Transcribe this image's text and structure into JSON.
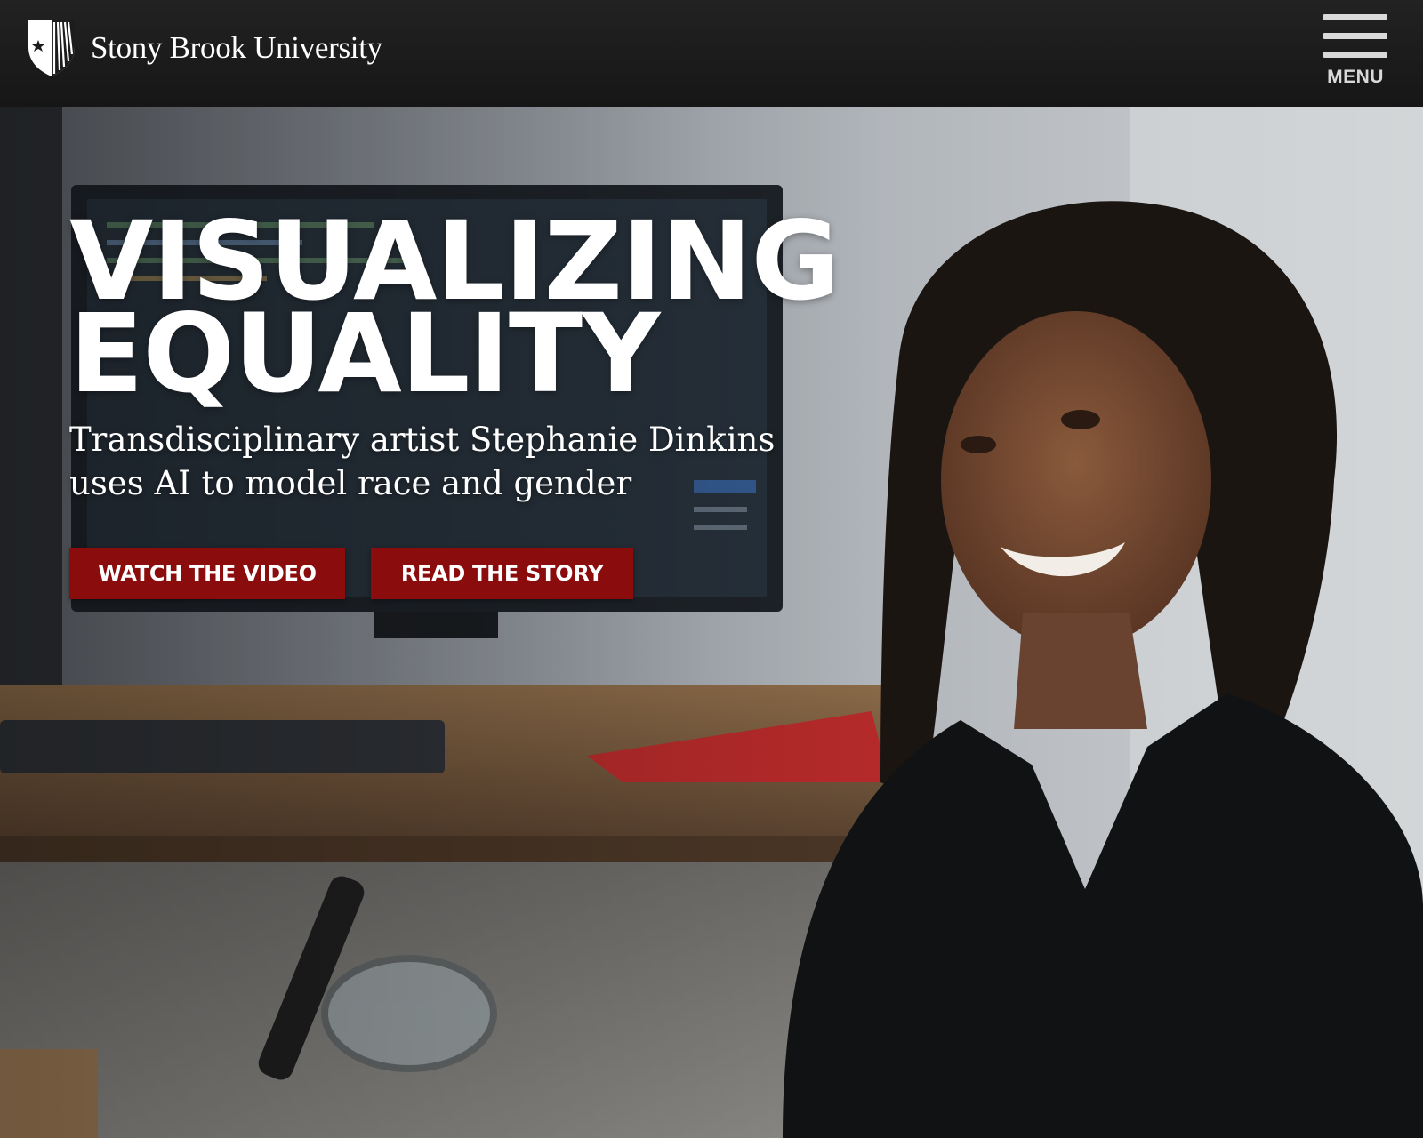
{
  "header": {
    "brand_name": "Stony Brook University",
    "menu_label": "MENU"
  },
  "hero": {
    "headline_line1": "VISUALIZING",
    "headline_line2": "EQUALITY",
    "subhead_line1": "Transdisciplinary artist Stephanie Dinkins",
    "subhead_line2": "uses AI to model race and gender",
    "buttons": {
      "watch_video": "WATCH THE VIDEO",
      "read_story": "READ THE STORY"
    }
  },
  "colors": {
    "header_bg": "#1c1c1c",
    "cta_red": "#8b0c0c",
    "text_white": "#ffffff"
  },
  "icons": {
    "logo": "university-shield-icon",
    "menu": "hamburger-menu-icon"
  }
}
